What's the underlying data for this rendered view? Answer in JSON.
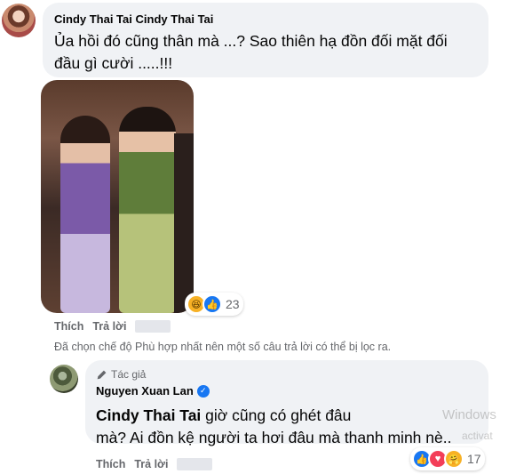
{
  "comment1": {
    "author": "Cindy Thai Tai",
    "tag": "Cindy Thai Tai",
    "text_line1": "Ủa hồi đó cũng thân mà ...? Sao thiên hạ đồn đối mặt đối",
    "text_line2": "đầu gì cười .....!!!",
    "reactions": [
      "haha",
      "like"
    ],
    "reaction_count": "23",
    "actions": {
      "like": "Thích",
      "reply": "Trả lời"
    }
  },
  "filter_note": "Đã chọn chế độ Phù hợp nhất nên một số câu trả lời có thể bị lọc ra.",
  "reply1": {
    "badge": "Tác giả",
    "author": "Nguyen Xuan Lan",
    "tag": "Cindy Thai Tai",
    "text_line1_rest": " giờ cũng có ghét đâu",
    "text_line2": "mà? Ai đồn kệ người ta hơi đâu mà thanh minh nè..",
    "reactions": [
      "like",
      "love",
      "care"
    ],
    "reaction_count": "17",
    "actions": {
      "like": "Thích",
      "reply": "Trả lời"
    }
  },
  "watermark": {
    "line1": "Windows",
    "line2": "activat"
  },
  "colors": {
    "bubble": "#f0f2f5",
    "secondary_text": "#65676b",
    "like_blue": "#1877f2",
    "love_red": "#f33e58"
  }
}
